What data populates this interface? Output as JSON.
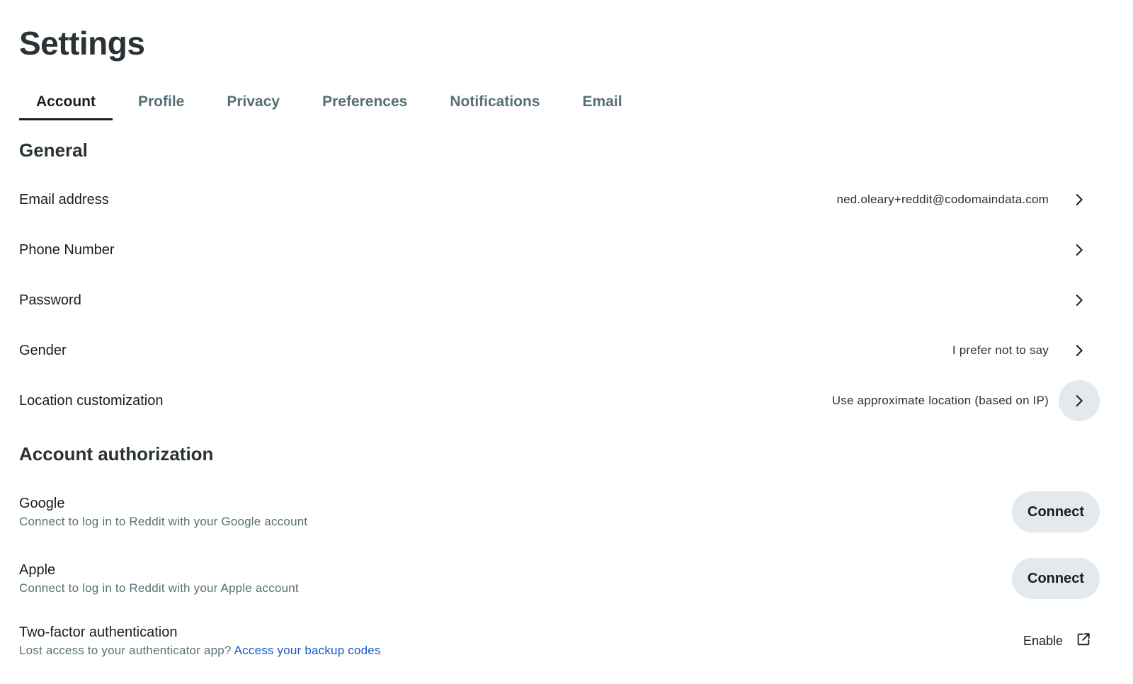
{
  "page": {
    "title": "Settings"
  },
  "tabs": [
    {
      "label": "Account",
      "active": true
    },
    {
      "label": "Profile"
    },
    {
      "label": "Privacy"
    },
    {
      "label": "Preferences"
    },
    {
      "label": "Notifications"
    },
    {
      "label": "Email"
    }
  ],
  "general": {
    "title": "General",
    "rows": [
      {
        "label": "Email address",
        "value": "ned.oleary+reddit@codomaindata.com",
        "icon": "chevron-right-icon"
      },
      {
        "label": "Phone Number",
        "value": "",
        "icon": "chevron-right-icon"
      },
      {
        "label": "Password",
        "value": "",
        "icon": "chevron-right-icon"
      },
      {
        "label": "Gender",
        "value": "I prefer not to say",
        "icon": "chevron-right-icon"
      },
      {
        "label": "Location customization",
        "value": "Use approximate location (based on IP)",
        "icon": "chevron-right-icon"
      }
    ]
  },
  "authorization": {
    "title": "Account authorization",
    "google": {
      "name": "Google",
      "description": "Connect to log in to Reddit with your Google account",
      "button": "Connect"
    },
    "apple": {
      "name": "Apple",
      "description": "Connect to log in to Reddit with your Apple account",
      "button": "Connect"
    },
    "two_factor": {
      "name": "Two-factor authentication",
      "description": "Lost access to your authenticator app?",
      "link": "Access your backup codes",
      "action": "Enable",
      "icon": "external-link-icon"
    }
  },
  "colors": {
    "text": "#1c1c1c",
    "muted": "#576f76",
    "link": "#1659c8",
    "button_bg": "#e3e9ec"
  }
}
